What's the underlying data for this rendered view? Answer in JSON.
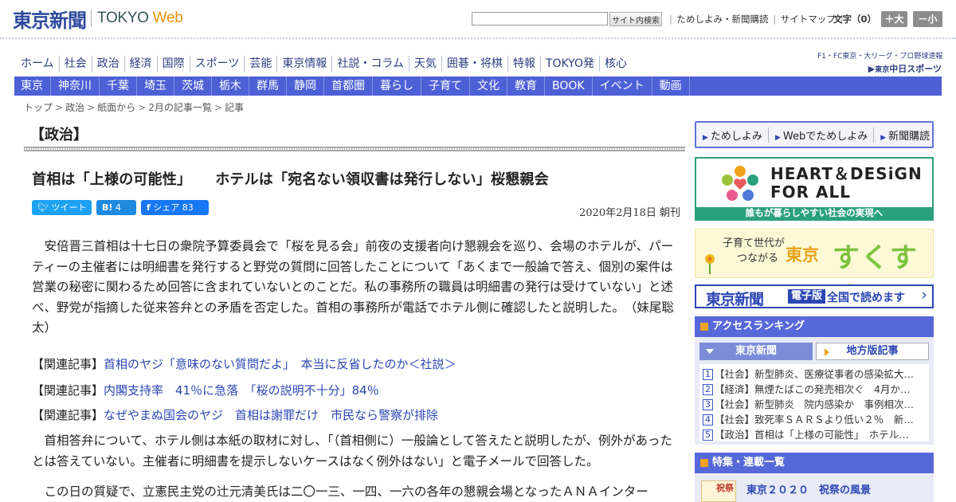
{
  "header": {
    "logo_jp": "東京新聞",
    "logo_en": "TOKYO",
    "logo_web": "Web",
    "search_placeholder": "",
    "search_button": "サイト内検索",
    "links": [
      "ためしよみ・新聞購読",
      "サイトマップ"
    ],
    "font_size_label": "文字（0）",
    "font_up": "＋大",
    "font_down": "－小"
  },
  "global_nav": [
    "ホーム",
    "社会",
    "政治",
    "経済",
    "国際",
    "スポーツ",
    "芸能",
    "東京情報",
    "社説・コラム",
    "天気",
    "囲碁・将棋",
    "特報",
    "TOKYO発",
    "核心"
  ],
  "chunichi": {
    "line1": "F1・FC東京・大リーグ・プロ野球速報",
    "tag": "東京",
    "name": "中日スポーツ"
  },
  "sub_nav": [
    "東京",
    "神奈川",
    "千葉",
    "埼玉",
    "茨城",
    "栃木",
    "群馬",
    "静岡",
    "首都圏",
    "暮らし",
    "子育て",
    "文化",
    "教育",
    "BOOK",
    "イベント",
    "動画"
  ],
  "breadcrumb": [
    "トップ",
    "政治",
    "紙面から",
    "2月の記事一覧",
    "記事"
  ],
  "article": {
    "section": "【政治】",
    "headline_a": "首相は「上様の可能性」",
    "headline_b": "ホテルは「宛名ない領収書は発行しない」桜懇親会",
    "share": {
      "tweet": "ツイート",
      "hatena_count": "4",
      "fb_label": "シェア",
      "fb_count": "83"
    },
    "date": "2020年2月18日 朝刊",
    "p1": "　安倍晋三首相は十七日の衆院予算委員会で「桜を見る会」前夜の支援者向け懇親会を巡り、会場のホテルが、パーティーの主催者には明細書を発行すると野党の質問に回答したことについて「あくまで一般論で答え、個別の案件は営業の秘密に関わるため回答に含まれていないとのことだ。私の事務所の職員は明細書の発行は受けていない」と述べ、野党が指摘した従来答弁との矛盾を否定した。首相の事務所が電話でホテル側に確認したと説明した。　（妹尾聡太）",
    "related_label": "【関連記事】",
    "related": [
      "首相のヤジ「意味のない質問だよ」　本当に反省したのか＜社説＞",
      "内閣支持率　41％に急落　「桜の説明不十分」84％",
      "なぜやまぬ国会のヤジ　首相は謝罪だけ　市民なら警察が排除"
    ],
    "p2": "　首相答弁について、ホテル側は本紙の取材に対し、「（首相側に）一般論として答えたと説明したが、例外があったとは答えていない。主催者に明細書を提示しないケースはなく例外はない」と電子メールで回答した。",
    "p3": "　この日の質疑で、立憲民主党の辻元清美氏は二〇一三、一四、一六の各年の懇親会場となったＡＮＡインター"
  },
  "sidebar": {
    "links": [
      "ためしよみ",
      "Webでためしよみ",
      "新聞購読"
    ],
    "heart_title_1": "HEART＆DESiGN",
    "heart_title_2": "FOR ALL",
    "heart_band": "誰もが暮らしやすい社会の実現へ",
    "suku_small_1": "子育て世代が",
    "suku_small_2": "つながる",
    "suku_big1": "東京",
    "suku_big2": "すくすく",
    "digital_brand": "東京新聞",
    "digital_tag": "電子版",
    "digital_msg": "全国で読めます",
    "ranking_title": "アクセスランキング",
    "ranking_tab1": "東京新聞",
    "ranking_tab2": "地方版記事",
    "ranking": [
      "1【社会】新型肺炎、医療従事者の感染拡大…",
      "2【経済】無煙たばこの発売相次ぐ　4月か…",
      "3【社会】新型肺炎　院内感染か　事例相次…",
      "4【社会】致死率ＳＡＲＳより低い２％　新…",
      "5【政治】首相は「上様の可能性」　ホテル…"
    ],
    "feature_title": "特集・連載一覧",
    "feature_item": "東京２０２０　祝祭の風景",
    "feature_thumb_text": "祝祭"
  }
}
